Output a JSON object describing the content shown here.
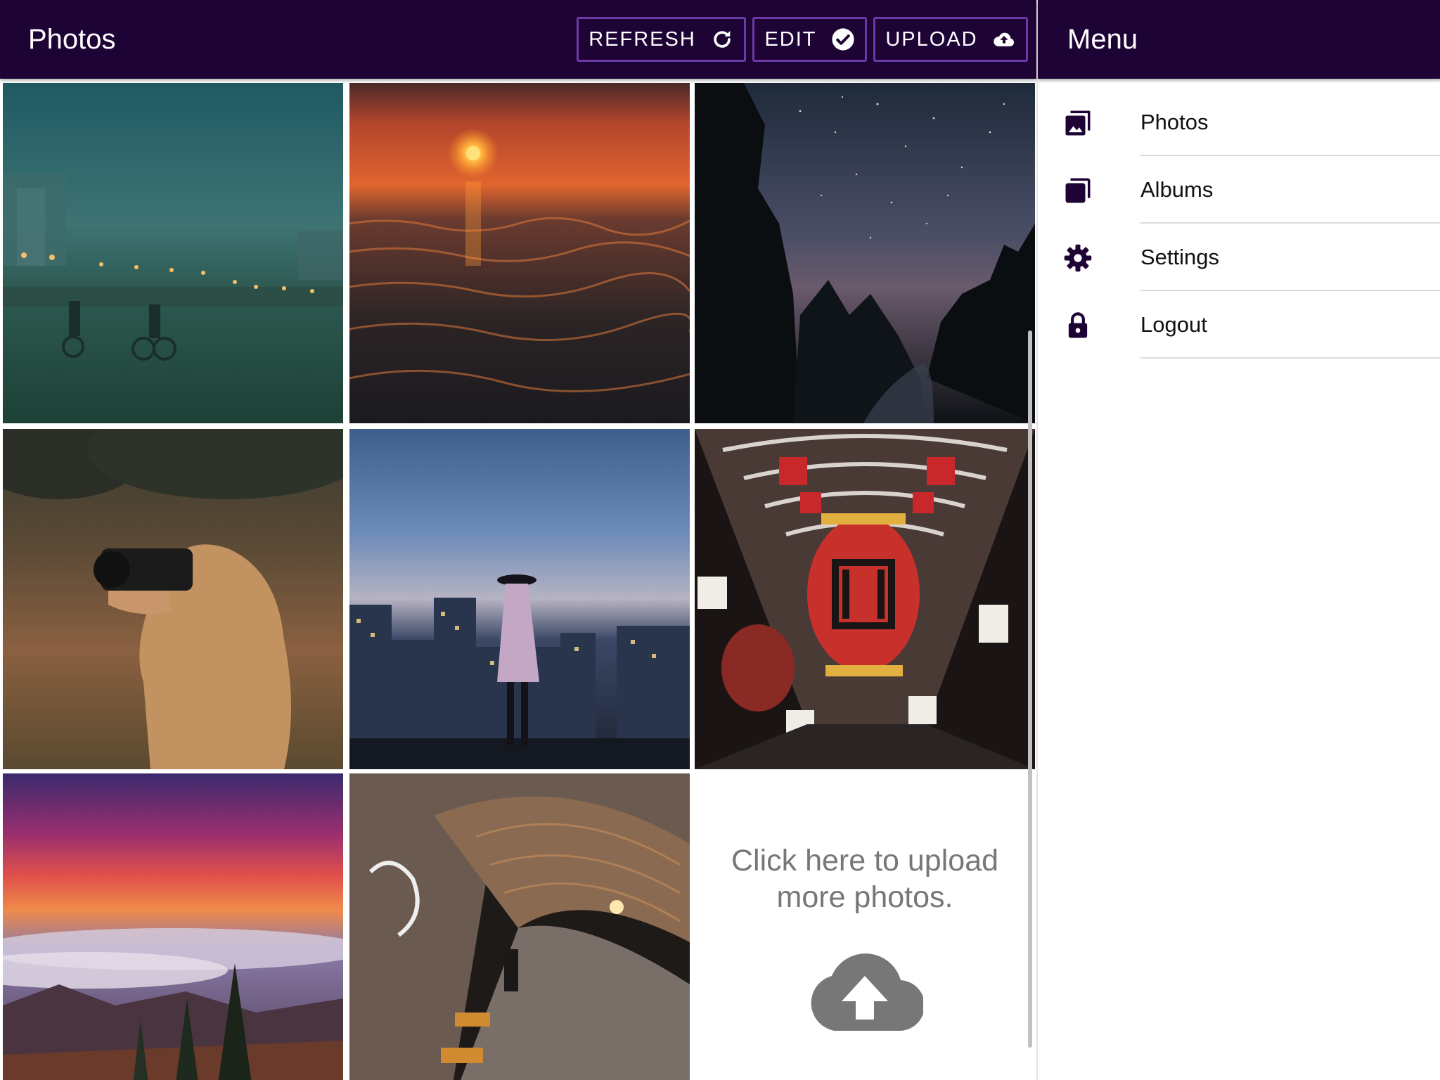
{
  "header": {
    "title": "Photos",
    "buttons": [
      {
        "label": "REFRESH",
        "icon": "refresh-icon"
      },
      {
        "label": "EDIT",
        "icon": "check-circle-icon"
      },
      {
        "label": "UPLOAD",
        "icon": "cloud-upload-icon"
      }
    ]
  },
  "photos": [
    {
      "subject": "cyclists-foggy-beach"
    },
    {
      "subject": "sunset-over-ocean"
    },
    {
      "subject": "starry-night-forest"
    },
    {
      "subject": "hooded-photographer"
    },
    {
      "subject": "woman-city-dusk"
    },
    {
      "subject": "lantern-arcade"
    },
    {
      "subject": "purple-sunset-mountains"
    },
    {
      "subject": "graffiti-tunnel-station"
    }
  ],
  "upload_tile": {
    "text": "Click here to upload more photos.",
    "icon": "cloud-upload-icon"
  },
  "menu": {
    "title": "Menu",
    "items": [
      {
        "label": "Photos",
        "icon": "photos-icon"
      },
      {
        "label": "Albums",
        "icon": "albums-icon"
      },
      {
        "label": "Settings",
        "icon": "gear-icon"
      },
      {
        "label": "Logout",
        "icon": "lock-icon"
      }
    ]
  },
  "colors": {
    "header_bg": "#1e0435",
    "button_border": "#6b3aa8",
    "upload_text": "#777777"
  }
}
